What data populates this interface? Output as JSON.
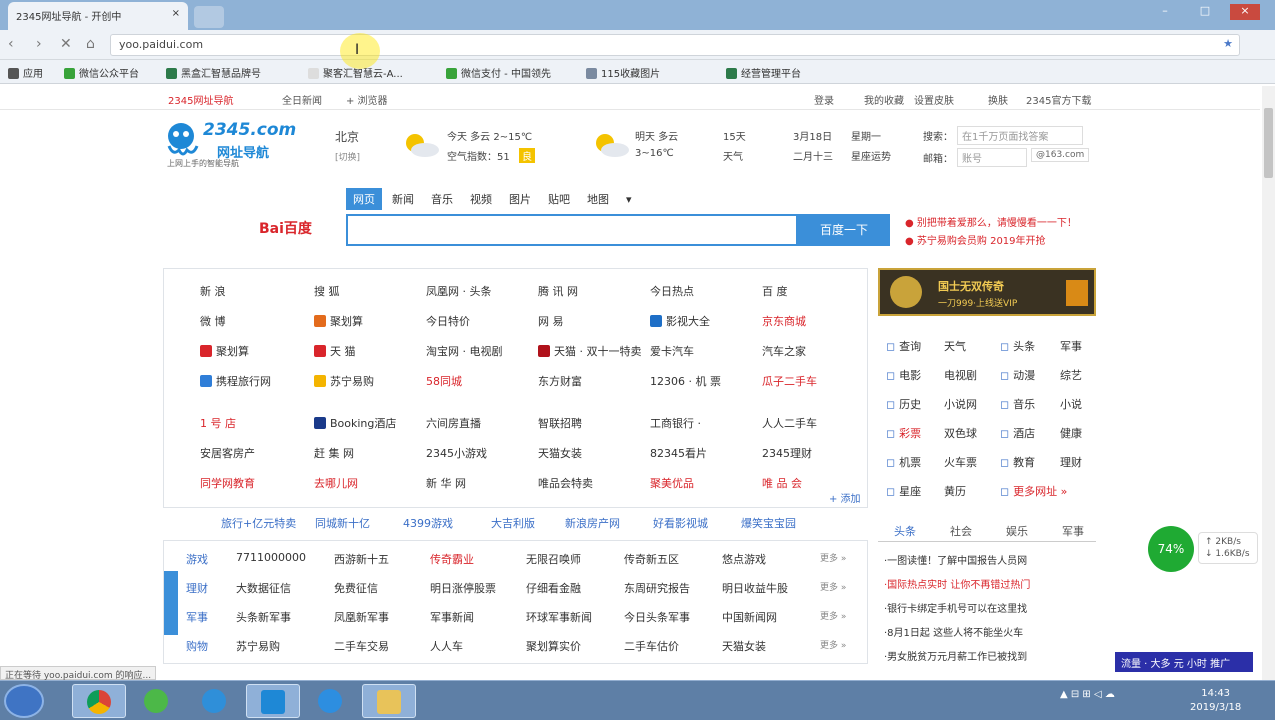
{
  "browser": {
    "tab_title": "2345网址导航 - 开创中",
    "tab_close": "×",
    "window_controls": [
      "–",
      "□",
      "×"
    ],
    "url": "yoo.paidui.com",
    "back": "‹",
    "forward": "›",
    "reload": "✕",
    "home": "⌂",
    "bookmarks": [
      "应用",
      "微信公众平台",
      "黑盒汇智慧品牌号",
      "聚客汇智慧云-A...",
      "微信支付 - 中国领先",
      "115收藏图片",
      "经营管理平台"
    ]
  },
  "top_links": {
    "left": [
      "2345网址导航",
      "全日新闻",
      "+ 浏览器"
    ],
    "right": [
      "登录",
      "我的收藏",
      "设置皮肤",
      "换肤",
      "2345官方下载"
    ]
  },
  "header": {
    "logo_text": "2345.com",
    "logo_sub": "网址导航",
    "logo_slogan": "上网上手的智能导航",
    "city": "北京",
    "city_sub": "[切换]",
    "today_weather": "今天 多云 2~15℃",
    "air_quality": "空气指数：51",
    "air_tag": "良",
    "tomorrow_weather": "明天 多云",
    "tomorrow_temp": "3~16℃",
    "weather_15": "15天",
    "weather_15b": "天气",
    "date1": "3月18日",
    "date1b": "星期一",
    "date2": "二月十三",
    "date2b": "星座运势",
    "search_label": "搜索：",
    "search_ph": "在1千万页面找答案",
    "mail_label": "邮箱：",
    "mail_ph": "账号",
    "mail_domain": "@163.com"
  },
  "search": {
    "tabs": [
      "网页",
      "新闻",
      "音乐",
      "视频",
      "图片",
      "贴吧",
      "地图"
    ],
    "more": "▾",
    "engine": "Bai百度",
    "button": "百度一下",
    "notes": [
      "● 别把带着爱那么，请慢慢看一一下！",
      "● 苏宁易购会员购 2019年开抢"
    ]
  },
  "links": [
    [
      {
        "text": "新 浪",
        "c": "n"
      },
      {
        "text": "搜 狐",
        "c": "n"
      },
      {
        "text": "凤凰网 · 头条",
        "c": "n"
      },
      {
        "text": "腾 讯 网",
        "c": "n"
      },
      {
        "text": "今日热点",
        "c": "n"
      },
      {
        "text": "百 度",
        "c": "n"
      }
    ],
    [
      {
        "text": "微 博",
        "c": "n"
      },
      {
        "text": "聚划算",
        "c": "n"
      },
      {
        "text": "今日特价",
        "c": "n"
      },
      {
        "text": "网 易",
        "c": "n"
      },
      {
        "text": "影视大全",
        "c": "n"
      },
      {
        "text": "京东商城",
        "c": "r"
      }
    ],
    [
      {
        "text": "聚划算",
        "c": "n"
      },
      {
        "text": "天 猫",
        "c": "n"
      },
      {
        "text": "淘宝网 · 电视剧",
        "c": "n"
      },
      {
        "text": "天猫 · 双十一特卖",
        "c": "n"
      },
      {
        "text": "爱卡汽车",
        "c": "n"
      },
      {
        "text": "汽车之家",
        "c": "n"
      }
    ],
    [
      {
        "text": "携程旅行网",
        "c": "n"
      },
      {
        "text": "苏宁易购",
        "c": "n"
      },
      {
        "text": "58同城",
        "c": "r"
      },
      {
        "text": "东方财富",
        "c": "n"
      },
      {
        "text": "12306 · 机 票",
        "c": "n"
      },
      {
        "text": "瓜子二手车",
        "c": "r"
      }
    ],
    [
      {
        "text": "1 号 店",
        "c": "r"
      },
      {
        "text": "Booking酒店",
        "c": "n"
      },
      {
        "text": "六间房直播",
        "c": "n"
      },
      {
        "text": "智联招聘",
        "c": "n"
      },
      {
        "text": "工商银行 ·",
        "c": "n"
      },
      {
        "text": "人人二手车",
        "c": "n"
      }
    ],
    [
      {
        "text": "安居客房产",
        "c": "n"
      },
      {
        "text": "赶 集 网",
        "c": "n"
      },
      {
        "text": "2345小游戏",
        "c": "n"
      },
      {
        "text": "天猫女装",
        "c": "n"
      },
      {
        "text": "82345看片",
        "c": "n"
      },
      {
        "text": "2345理财",
        "c": "n"
      }
    ],
    [
      {
        "text": "同学网教育",
        "c": "r"
      },
      {
        "text": "去哪儿网",
        "c": "r"
      },
      {
        "text": "新 华 网",
        "c": "n"
      },
      {
        "text": "唯品会特卖",
        "c": "n"
      },
      {
        "text": "聚美优品",
        "c": "r"
      },
      {
        "text": "唯 品 会",
        "c": "r"
      }
    ]
  ],
  "links_more": "+ 添加",
  "banner": {
    "title": "国士无双传奇",
    "sub": "一刀999·上线送VIP"
  },
  "services": [
    {
      "icon": "查",
      "a": "查询",
      "b": "天气",
      "icon2": "头",
      "c": "头条",
      "d": "军事"
    },
    {
      "icon": "电",
      "a": "电影",
      "b": "电视剧",
      "icon2": "动",
      "c": "动漫",
      "d": "综艺"
    },
    {
      "icon": "历",
      "a": "历史",
      "b": "小说网",
      "icon2": "音",
      "c": "音乐",
      "d": "小说"
    },
    {
      "icon": "彩",
      "a": "彩票",
      "b": "双色球",
      "icon2": "酒",
      "c": "酒店",
      "d": "健康"
    },
    {
      "icon": "机",
      "a": "机票",
      "b": "火车票",
      "icon2": "教",
      "c": "教育",
      "d": "理财"
    },
    {
      "icon": "星",
      "a": "星座",
      "b": "黄历",
      "icon2": "更",
      "c": "更多网址 »",
      "d": ""
    }
  ],
  "cat_row": [
    "旅行+亿元特卖",
    "同城新十亿",
    "4399游戏",
    "大吉利版",
    "新浪房产网",
    "好看影视城",
    "爆笑宝宝园"
  ],
  "cats": [
    {
      "head": "游戏",
      "items": [
        "7711000000",
        "西游新十五",
        "传奇霸业",
        "无限召唤师",
        "传奇新五区",
        "悠点游戏"
      ],
      "more": "更多 »"
    },
    {
      "head": "理财",
      "items": [
        "大数据征信",
        "免费征信",
        "明日涨停股票",
        "仔细看金融",
        "东周研究报告",
        "明日收益牛股"
      ],
      "more": "更多 »"
    },
    {
      "head": "军事",
      "items": [
        "头条新军事",
        "凤凰新军事",
        "军事新闻",
        "环球军事新闻",
        "今日头条军事",
        "中国新闻网"
      ],
      "more": "更多 »"
    },
    {
      "head": "购物",
      "items": [
        "苏宁易购",
        "二手车交易",
        "人人车",
        "聚划算实价",
        "二手车估价",
        "天猫女装"
      ],
      "more": "更多 »"
    }
  ],
  "news": {
    "tabs": [
      "头条",
      "社会",
      "娱乐",
      "军事"
    ],
    "items": [
      {
        "text": "·一图读懂！了解中国报告人员网",
        "c": "n"
      },
      {
        "text": "·国际热点实时 让你不再错过热门",
        "c": "r"
      },
      {
        "text": "·银行卡绑定手机号可以在这里找",
        "c": "n"
      },
      {
        "text": "·8月1日起 这些人将不能坐火车",
        "c": "n"
      },
      {
        "text": "·男女脱贫万元月薪工作已被找到",
        "c": "n"
      }
    ]
  },
  "speed": {
    "value": "74%",
    "line1": "↑ 2KB/s",
    "line2": "↓ 1.6KB/s"
  },
  "status_url": "正在等待 yoo.paidui.com 的响应...",
  "ad_text": "流量 · 大多 元 小时 推广",
  "taskbar": {
    "time": "14:43",
    "date": "2019/3/18"
  }
}
